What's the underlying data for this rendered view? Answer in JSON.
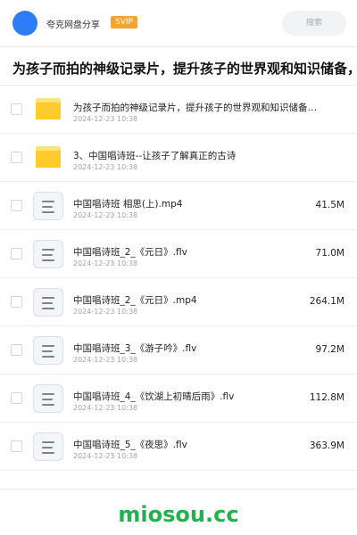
{
  "header": {
    "app_name": "夸克网盘分享",
    "badge": "SVIP",
    "search_placeholder": "搜索",
    "accent_color": "#2f7df6"
  },
  "share_title": "为孩子而拍的神级记录片，提升孩子的世界观和知识储备，",
  "items": [
    {
      "type": "folder",
      "icon": "folder-icon",
      "name": "为孩子而拍的神级记录片，提升孩子的世界观和知识储备…",
      "date": "2024-12-23 10:38",
      "size": ""
    },
    {
      "type": "folder",
      "icon": "folder-icon",
      "name": "3、中国唱诗班--让孩子了解真正的古诗",
      "date": "2024-12-23 10:38",
      "size": ""
    },
    {
      "type": "file",
      "icon": "document-icon",
      "name": "中国唱诗班 相思(上).mp4",
      "date": "2024-12-23 10:38",
      "size": "41.5M"
    },
    {
      "type": "file",
      "icon": "document-icon",
      "name": "中国唱诗班_2_《元日》.flv",
      "date": "2024-12-23 10:38",
      "size": "71.0M"
    },
    {
      "type": "file",
      "icon": "document-icon",
      "name": "中国唱诗班_2_《元日》.mp4",
      "date": "2024-12-23 10:38",
      "size": "264.1M"
    },
    {
      "type": "file",
      "icon": "document-icon",
      "name": "中国唱诗班_3_《游子吟》.flv",
      "date": "2024-12-23 10:38",
      "size": "97.2M"
    },
    {
      "type": "file",
      "icon": "document-icon",
      "name": "中国唱诗班_4_《饮湖上初晴后雨》.flv",
      "date": "2024-12-23 10:38",
      "size": "112.8M"
    },
    {
      "type": "file",
      "icon": "document-icon",
      "name": "中国唱诗班_5_《夜思》.flv",
      "date": "2024-12-23 10:38",
      "size": "363.9M"
    }
  ],
  "watermark": "miosou.cc",
  "watermark_color": "#22b14c"
}
